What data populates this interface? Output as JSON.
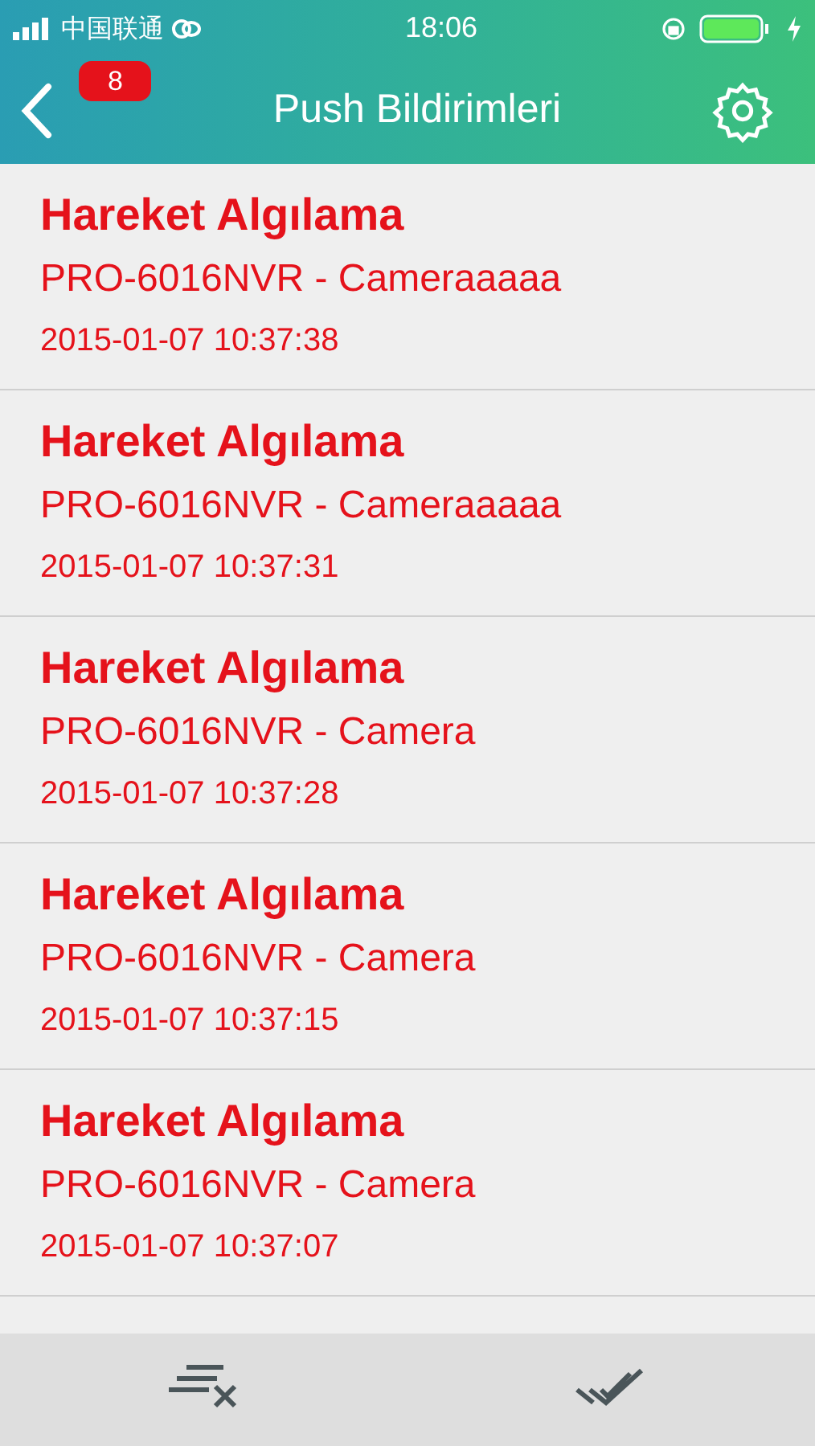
{
  "status_bar": {
    "carrier": "中国联通",
    "time": "18:06"
  },
  "header": {
    "title": "Push Bildirimleri",
    "badge": "8"
  },
  "notifications": [
    {
      "title": "Hareket Algılama",
      "source": "PRO-6016NVR - Cameraaaaa",
      "time": "2015-01-07 10:37:38"
    },
    {
      "title": "Hareket Algılama",
      "source": "PRO-6016NVR - Cameraaaaa",
      "time": "2015-01-07 10:37:31"
    },
    {
      "title": "Hareket Algılama",
      "source": "PRO-6016NVR - Camera",
      "time": "2015-01-07 10:37:28"
    },
    {
      "title": "Hareket Algılama",
      "source": "PRO-6016NVR - Camera",
      "time": "2015-01-07 10:37:15"
    },
    {
      "title": "Hareket Algılama",
      "source": "PRO-6016NVR - Camera",
      "time": "2015-01-07 10:37:07"
    }
  ]
}
